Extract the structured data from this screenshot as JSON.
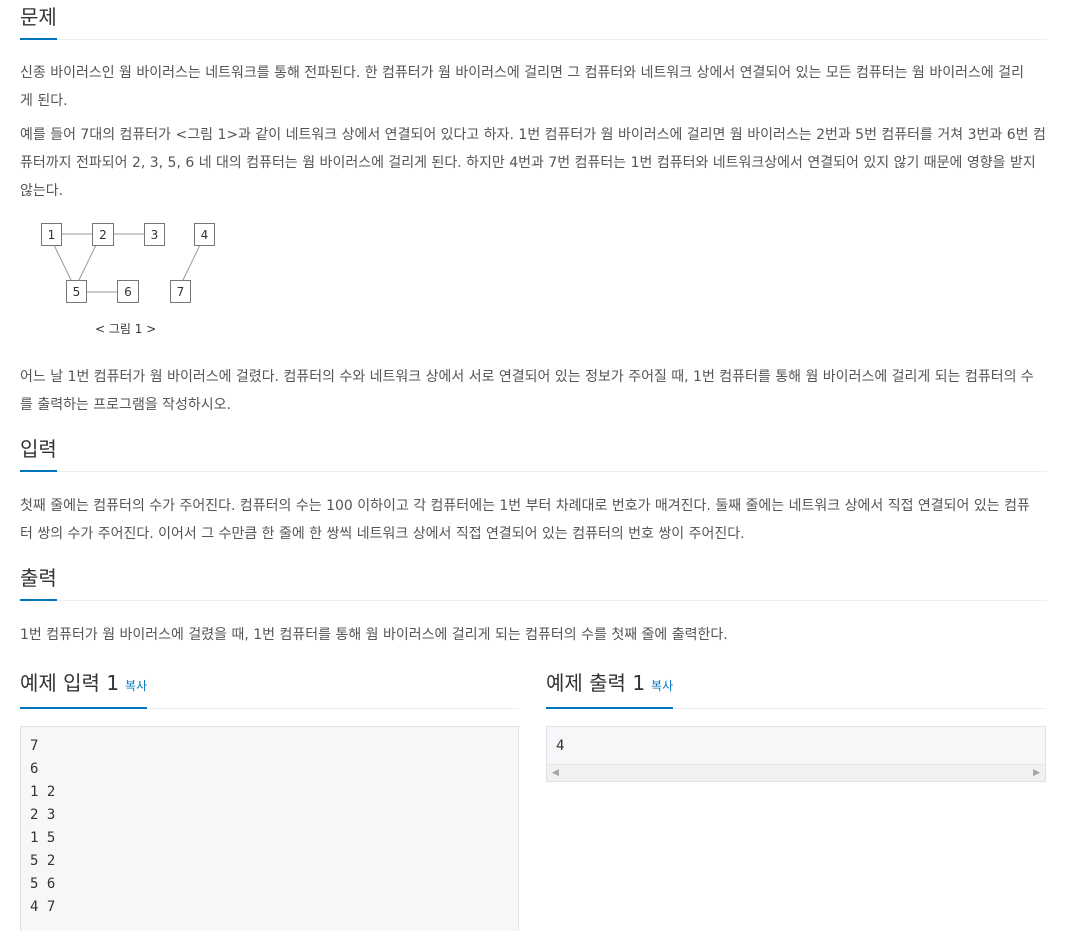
{
  "problem": {
    "title": "문제",
    "p1_line1": "신종 바이러스인 웜 바이러스는 네트워크를 통해 전파된다. 한 컴퓨터가 웜 바이러스에 걸리면 그 컴퓨터와 네트워크 상에서 연결되어 있는 모든 컴퓨터는 웜 바이러스에 걸리",
    "p1_line2": "게 된다.",
    "p2_line1": "예를 들어 7대의 컴퓨터가 <그림 1>과 같이 네트워크 상에서 연결되어 있다고 하자. 1번 컴퓨터가 웜 바이러스에 걸리면 웜 바이러스는 2번과 5번 컴퓨터를 거쳐 3번과 6번 컴",
    "p2_line2": "퓨터까지 전파되어 2, 3, 5, 6 네 대의 컴퓨터는 웜 바이러스에 걸리게 된다. 하지만 4번과 7번 컴퓨터는 1번 컴퓨터와 네트워크상에서 연결되어 있지 않기 때문에 영향을 받지",
    "p2_line3": "않는다.",
    "figure": {
      "nodes": [
        "1",
        "2",
        "3",
        "4",
        "5",
        "6",
        "7"
      ],
      "caption": "< 그림 1 >"
    },
    "p3_line1": "어느 날 1번 컴퓨터가 웜 바이러스에 걸렸다. 컴퓨터의 수와 네트워크 상에서 서로 연결되어 있는 정보가 주어질 때, 1번 컴퓨터를 통해 웜 바이러스에 걸리게 되는 컴퓨터의 수",
    "p3_line2": "를 출력하는 프로그램을 작성하시오."
  },
  "input": {
    "title": "입력",
    "line1": "첫째 줄에는 컴퓨터의 수가 주어진다. 컴퓨터의 수는 100 이하이고 각 컴퓨터에는 1번 부터 차례대로 번호가 매겨진다. 둘째 줄에는 네트워크 상에서 직접 연결되어 있는 컴퓨",
    "line2": "터 쌍의 수가 주어진다. 이어서 그 수만큼 한 줄에 한 쌍씩 네트워크 상에서 직접 연결되어 있는 컴퓨터의 번호 쌍이 주어진다."
  },
  "output": {
    "title": "출력",
    "line1": "1번 컴퓨터가 웜 바이러스에 걸렸을 때, 1번 컴퓨터를 통해 웜 바이러스에 걸리게 되는 컴퓨터의 수를 첫째 줄에 출력한다."
  },
  "sample_input": {
    "title": "예제 입력 1",
    "copy_label": "복사",
    "content": "7\n6\n1 2\n2 3\n1 5\n5 2\n5 6\n4 7"
  },
  "sample_output": {
    "title": "예제 출력 1",
    "copy_label": "복사",
    "content": "4"
  },
  "colors": {
    "accent": "#0076c0",
    "text": "#555555",
    "code_bg": "#f7f7f9"
  }
}
